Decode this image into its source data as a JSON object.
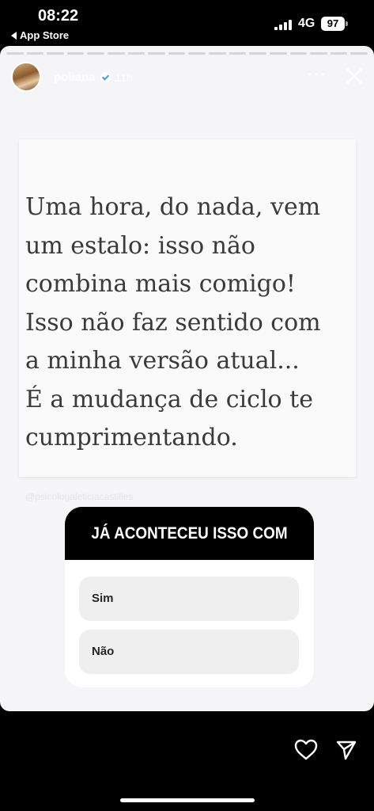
{
  "status": {
    "time": "08:22",
    "back_app": "App Store",
    "network": "4G",
    "battery": "97"
  },
  "story": {
    "username": "poliana",
    "time_ago": "11h",
    "quote_lines": [
      "Uma hora, do nada, vem",
      "um estalo: isso não",
      "combina mais comigo!",
      "Isso não faz sentido com",
      "a minha versão atual...",
      "É a mudança de ciclo te",
      "cumprimentando."
    ],
    "watermark": "@psicologaleticiacastilles"
  },
  "poll": {
    "question": "JÁ ACONTECEU ISSO COM VC?",
    "options": [
      "Sim",
      "Não"
    ]
  },
  "colors": {
    "story_bg": "#f5f5f7",
    "poll_header": "#000000",
    "option_bg": "#efefef"
  },
  "icons": {
    "like": "heart-icon",
    "share": "send-icon",
    "close": "close-icon",
    "more": "more-icon",
    "verified": "verified-badge-icon"
  }
}
